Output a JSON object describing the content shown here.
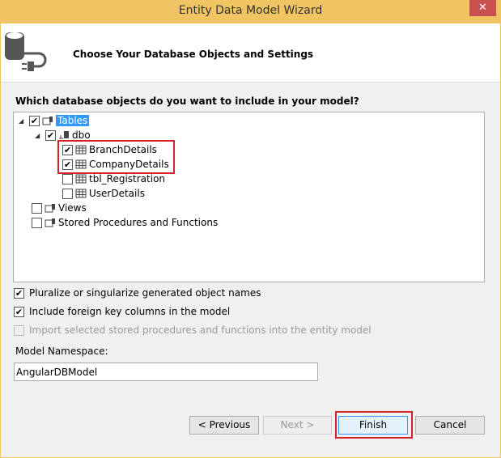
{
  "window": {
    "title": "Entity Data Model Wizard",
    "close": "✕"
  },
  "header": {
    "title": "Choose Your Database Objects and Settings"
  },
  "question": "Which database objects do you want to include in your model?",
  "tree": [
    {
      "label": "Tables",
      "checked": true,
      "selected": true
    },
    {
      "label": "dbo",
      "checked": true
    },
    {
      "label": "BranchDetails",
      "checked": true
    },
    {
      "label": "CompanyDetails",
      "checked": true
    },
    {
      "label": "tbl_Registration",
      "checked": false
    },
    {
      "label": "UserDetails",
      "checked": false
    },
    {
      "label": "Views",
      "checked": false
    },
    {
      "label": "Stored Procedures and Functions",
      "checked": false
    }
  ],
  "options": [
    {
      "label": "Pluralize or singularize generated object names",
      "checked": true,
      "enabled": true
    },
    {
      "label": "Include foreign key columns in the model",
      "checked": true,
      "enabled": true
    },
    {
      "label": "Import selected stored procedures and functions into the entity model",
      "checked": false,
      "enabled": false
    }
  ],
  "namespace": {
    "label": "Model Namespace:",
    "value": "AngularDBModel"
  },
  "buttons": {
    "previous": "< Previous",
    "next": "Next >",
    "finish": "Finish",
    "cancel": "Cancel"
  },
  "colors": {
    "titlebar": "#f0c463",
    "highlight": "#d2232a",
    "selection": "#3399ff"
  }
}
